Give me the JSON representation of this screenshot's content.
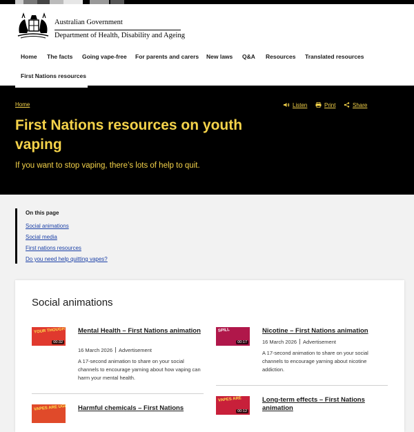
{
  "brand": {
    "gov_name": "Australian Government",
    "dept_name": "Department of Health, Disability and Ageing"
  },
  "nav": {
    "items": [
      {
        "label": "Home"
      },
      {
        "label": "The facts"
      },
      {
        "label": "Going vape-free"
      },
      {
        "label": "For parents and carers"
      },
      {
        "label": "New laws"
      },
      {
        "label": "Q&A"
      },
      {
        "label": "Resources"
      },
      {
        "label": "Translated resources"
      },
      {
        "label": "First Nations resources"
      }
    ],
    "active": "First Nations resources"
  },
  "hero": {
    "breadcrumb": "Home",
    "title": "First Nations resources on youth vaping",
    "subtitle": "If you want to stop vaping, there’s lots of help to quit.",
    "tools": {
      "listen": "Listen",
      "print": "Print",
      "share": "Share"
    }
  },
  "toc": {
    "title": "On this page",
    "links": [
      "Social animations",
      "Social media",
      "First nations resources",
      "Do you need help quitting vapes?"
    ]
  },
  "section": {
    "title": "Social animations",
    "items": [
      {
        "title": "Mental Health – First Nations animation",
        "date": "16 March 2026",
        "type": "Advertisement",
        "description": "A 17-second animation to share on your social channels to encourage yarning about how vaping can harm your mental health.",
        "thumb_text": "YOUR THOUGHTS",
        "duration": "00:32"
      },
      {
        "title": "Nicotine – First Nations animation",
        "date": "16 March 2026",
        "type": "Advertisement",
        "description": "A 17-second animation to share on your social channels to encourage yarning about nicotine addiction.",
        "thumb_text": "SPILL",
        "duration": "00:17"
      },
      {
        "title": "Harmful chemicals – First Nations",
        "thumb_text": "VAPES ARE UGLY"
      },
      {
        "title": "Long-term effects – First Nations animation",
        "thumb_text": "VAPES ARE",
        "duration": "00:12"
      }
    ]
  },
  "colors": {
    "accent_yellow": "#f5d34a",
    "hero_bg": "#000000",
    "link_blue": "#1a3fa6"
  }
}
